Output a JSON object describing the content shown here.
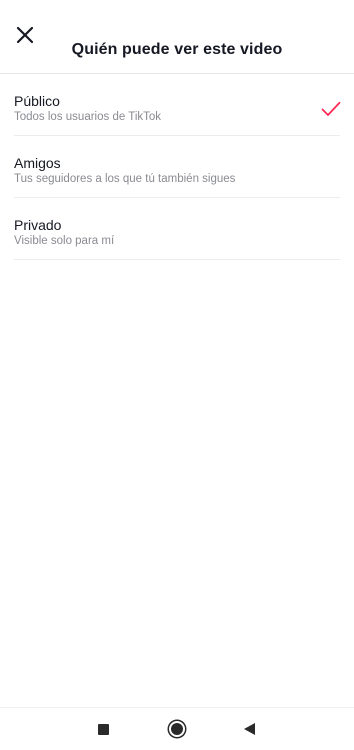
{
  "header": {
    "title": "Quién puede ver este video",
    "close_icon": "close-icon"
  },
  "options": [
    {
      "label": "Público",
      "description": "Todos los usuarios de TikTok",
      "selected": true
    },
    {
      "label": "Amigos",
      "description": "Tus seguidores a los que tú también sigues",
      "selected": false
    },
    {
      "label": "Privado",
      "description": "Visible solo para mí",
      "selected": false
    }
  ],
  "colors": {
    "accent": "#fe2c55",
    "text_primary": "#161823",
    "text_secondary": "#8a8b91",
    "divider": "#ececee"
  },
  "navbar": {
    "icons": [
      "recent-apps-icon",
      "home-icon",
      "back-icon"
    ]
  }
}
